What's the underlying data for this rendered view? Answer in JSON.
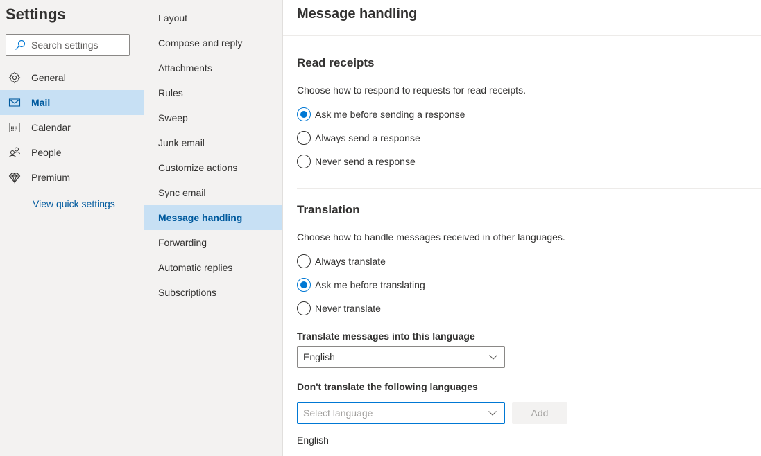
{
  "sidebar": {
    "title": "Settings",
    "search": {
      "placeholder": "Search settings",
      "value": ""
    },
    "items": [
      {
        "label": "General",
        "icon": "gear-icon",
        "selected": false
      },
      {
        "label": "Mail",
        "icon": "mail-icon",
        "selected": true
      },
      {
        "label": "Calendar",
        "icon": "calendar-icon",
        "selected": false
      },
      {
        "label": "People",
        "icon": "people-icon",
        "selected": false
      },
      {
        "label": "Premium",
        "icon": "diamond-icon",
        "selected": false
      }
    ],
    "quick_settings_link": "View quick settings"
  },
  "subnav": {
    "items": [
      {
        "label": "Layout",
        "selected": false
      },
      {
        "label": "Compose and reply",
        "selected": false
      },
      {
        "label": "Attachments",
        "selected": false
      },
      {
        "label": "Rules",
        "selected": false
      },
      {
        "label": "Sweep",
        "selected": false
      },
      {
        "label": "Junk email",
        "selected": false
      },
      {
        "label": "Customize actions",
        "selected": false
      },
      {
        "label": "Sync email",
        "selected": false
      },
      {
        "label": "Message handling",
        "selected": true
      },
      {
        "label": "Forwarding",
        "selected": false
      },
      {
        "label": "Automatic replies",
        "selected": false
      },
      {
        "label": "Subscriptions",
        "selected": false
      }
    ]
  },
  "main": {
    "title": "Message handling",
    "read_receipts": {
      "title": "Read receipts",
      "description": "Choose how to respond to requests for read receipts.",
      "options": [
        {
          "label": "Ask me before sending a response",
          "checked": true
        },
        {
          "label": "Always send a response",
          "checked": false
        },
        {
          "label": "Never send a response",
          "checked": false
        }
      ]
    },
    "translation": {
      "title": "Translation",
      "description": "Choose how to handle messages received in other languages.",
      "options": [
        {
          "label": "Always translate",
          "checked": false
        },
        {
          "label": "Ask me before translating",
          "checked": true
        },
        {
          "label": "Never translate",
          "checked": false
        }
      ],
      "translate_into_label": "Translate messages into this language",
      "translate_into_value": "English",
      "dont_translate_label": "Don't translate the following languages",
      "select_language_placeholder": "Select language",
      "add_button": "Add",
      "excluded_languages": [
        "English"
      ]
    }
  },
  "colors": {
    "accent": "#0078d4",
    "selected_bg": "#c7e0f4",
    "selected_text": "#005a9e",
    "pane_bg": "#f3f2f1"
  }
}
